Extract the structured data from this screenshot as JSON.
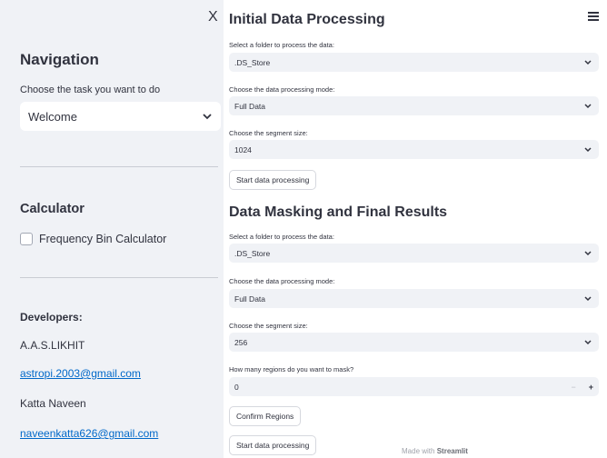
{
  "sidebar": {
    "close_glyph": "X",
    "nav_title": "Navigation",
    "task_label": "Choose the task you want to do",
    "task_value": "Welcome",
    "calc_title": "Calculator",
    "calc_checkbox_label": "Frequency Bin Calculator",
    "developers_title": "Developers:",
    "dev1_name": "A.A.S.LIKHIT",
    "dev1_email": "astropi.2003@gmail.com",
    "dev2_name": "Katta Naveen",
    "dev2_email": "naveenkatta626@gmail.com"
  },
  "section1": {
    "title": "Initial Data Processing",
    "folder_label": "Select a folder to process the data:",
    "folder_value": ".DS_Store",
    "mode_label": "Choose the data processing mode:",
    "mode_value": "Full Data",
    "segment_label": "Choose the segment size:",
    "segment_value": "1024",
    "start_button": "Start data processing"
  },
  "section2": {
    "title": "Data Masking and Final Results",
    "folder_label": "Select a folder to process the data:",
    "folder_value": ".DS_Store",
    "mode_label": "Choose the data processing mode:",
    "mode_value": "Full Data",
    "segment_label": "Choose the segment size:",
    "segment_value": "256",
    "regions_label": "How many regions do you want to mask?",
    "regions_value": "0",
    "minus_glyph": "−",
    "plus_glyph": "+",
    "confirm_button": "Confirm Regions",
    "start_button": "Start data processing"
  },
  "footer": {
    "made_with": "Made with",
    "brand": "Streamlit"
  },
  "icons": {
    "chevron": "chevron-down-icon",
    "menu": "hamburger-menu-icon",
    "close": "close-icon",
    "checkbox": "checkbox-icon"
  },
  "colors": {
    "sidebar_bg": "#f0f2f6",
    "input_bg": "#f0f2f6",
    "text": "#31333f",
    "link": "#0068c9"
  }
}
